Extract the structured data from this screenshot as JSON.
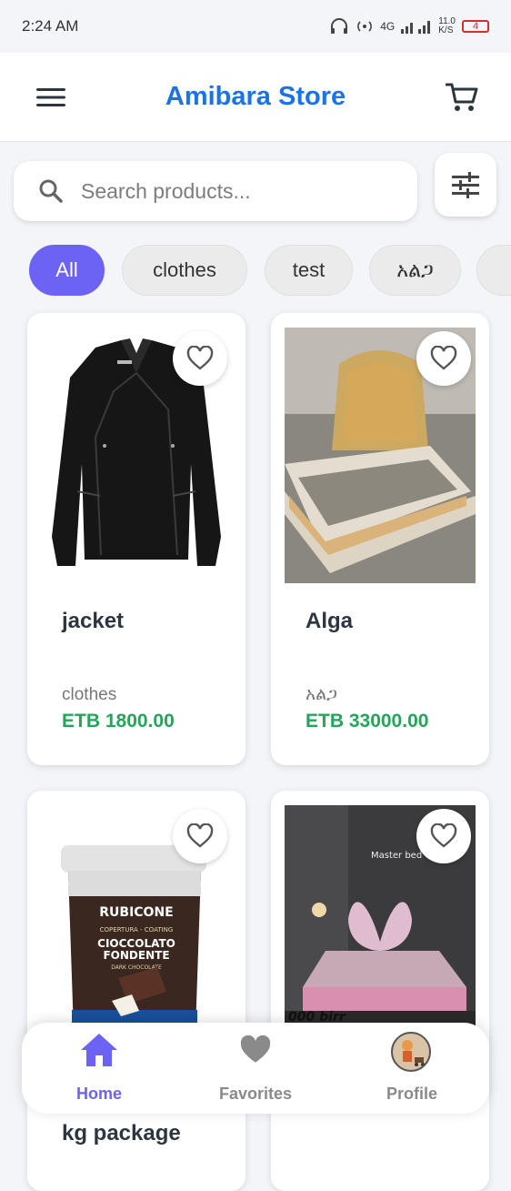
{
  "status_bar": {
    "time": "2:24 AM",
    "network": "4G",
    "speed_value": "11.0",
    "speed_unit": "K/S",
    "battery": "4"
  },
  "header": {
    "title": "Amibara Store",
    "menu_icon": "hamburger-menu-icon",
    "cart_icon": "cart-icon"
  },
  "search": {
    "placeholder": "Search products...",
    "value": ""
  },
  "categories": [
    {
      "label": "All",
      "active": true
    },
    {
      "label": "clothes",
      "active": false
    },
    {
      "label": "test",
      "active": false
    },
    {
      "label": "አልጋ",
      "active": false
    }
  ],
  "products": [
    {
      "name": "jacket",
      "category": "clothes",
      "price": "ETB 1800.00"
    },
    {
      "name": "Alga",
      "category": "አልጋ",
      "price": "ETB 33000.00"
    },
    {
      "name": "kg package",
      "category": "",
      "price": ""
    },
    {
      "name": "",
      "category": "",
      "price": ""
    }
  ],
  "product_images": {
    "bucket_brand": "RUBICONE",
    "bucket_line1": "COPERTURA - COATING",
    "bucket_line2": "CIOCCOLATO",
    "bucket_line3": "FONDENTE",
    "bucket_line4": "DARK CHOCOLATE",
    "bed_sign": "Master bed",
    "bed_price": "000 birr"
  },
  "bottom_nav": [
    {
      "label": "Home",
      "icon": "home-icon",
      "active": true
    },
    {
      "label": "Favorites",
      "icon": "heart-icon",
      "active": false
    },
    {
      "label": "Profile",
      "icon": "avatar",
      "active": false
    }
  ],
  "colors": {
    "accent": "#6c63f5",
    "title": "#1a73e8",
    "price": "#23a55a",
    "inactive": "#8a8a8a"
  }
}
